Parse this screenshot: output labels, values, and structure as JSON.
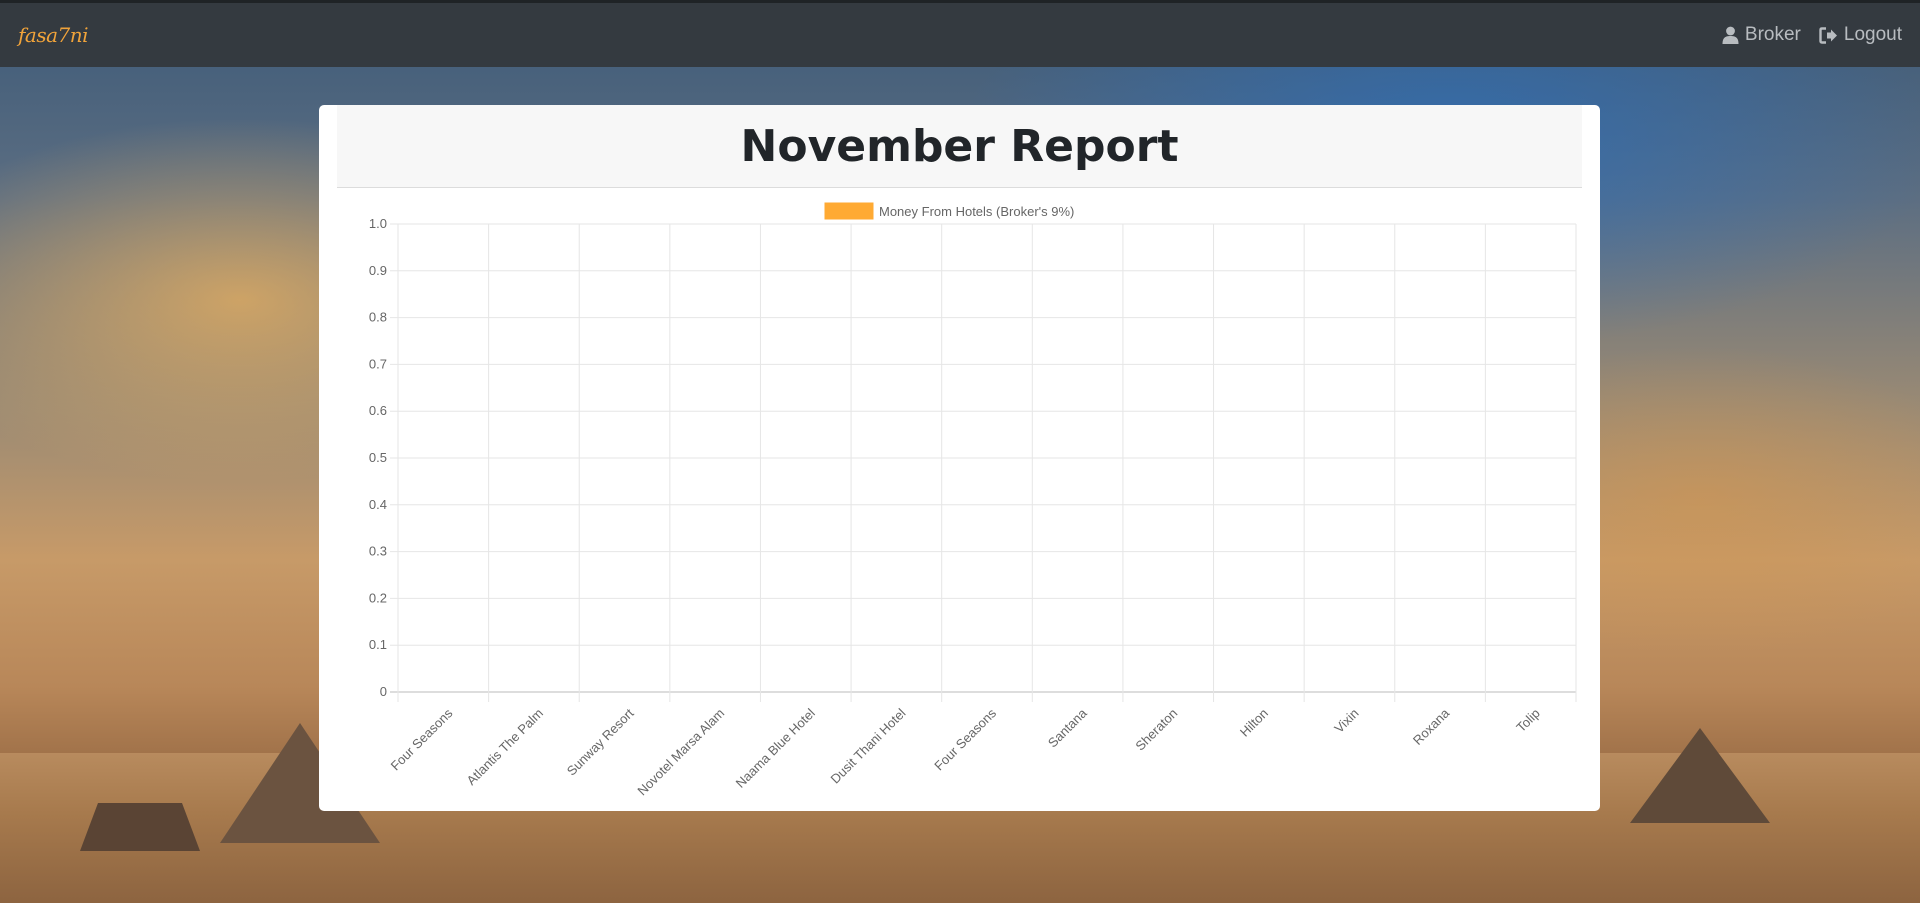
{
  "navbar": {
    "brand": "fasa7ni",
    "user_label": "Broker",
    "logout_label": "Logout"
  },
  "report": {
    "title": "November Report"
  },
  "colors": {
    "navbar_bg": "#343a40",
    "brand": "#f0a33a",
    "series_fill": "#ffaa33"
  },
  "icons": {
    "user": "user-icon",
    "logout": "sign-out-icon"
  },
  "chart_data": {
    "type": "bar",
    "categories": [
      "Four Seasons",
      "Atlantis The Palm",
      "Sunway Resort",
      "Novotel Marsa Alam",
      "Naama Blue Hotel",
      "Dusit Thani Hotel",
      "Four Seasons",
      "Santana",
      "Sheraton",
      "Hilton",
      "Vixin",
      "Roxana",
      "Tolip"
    ],
    "series": [
      {
        "name": "Money From Hotels (Broker's 9%)",
        "values": [
          0,
          0,
          0,
          0,
          0,
          0,
          0,
          0,
          0,
          0,
          0,
          0,
          0
        ],
        "color": "#ffaa33"
      }
    ],
    "ylim": [
      0,
      1
    ],
    "yticks": [
      "0",
      "0.1",
      "0.2",
      "0.3",
      "0.4",
      "0.5",
      "0.6",
      "0.7",
      "0.8",
      "0.9",
      "1.0"
    ],
    "grid": true,
    "legend": "top"
  }
}
